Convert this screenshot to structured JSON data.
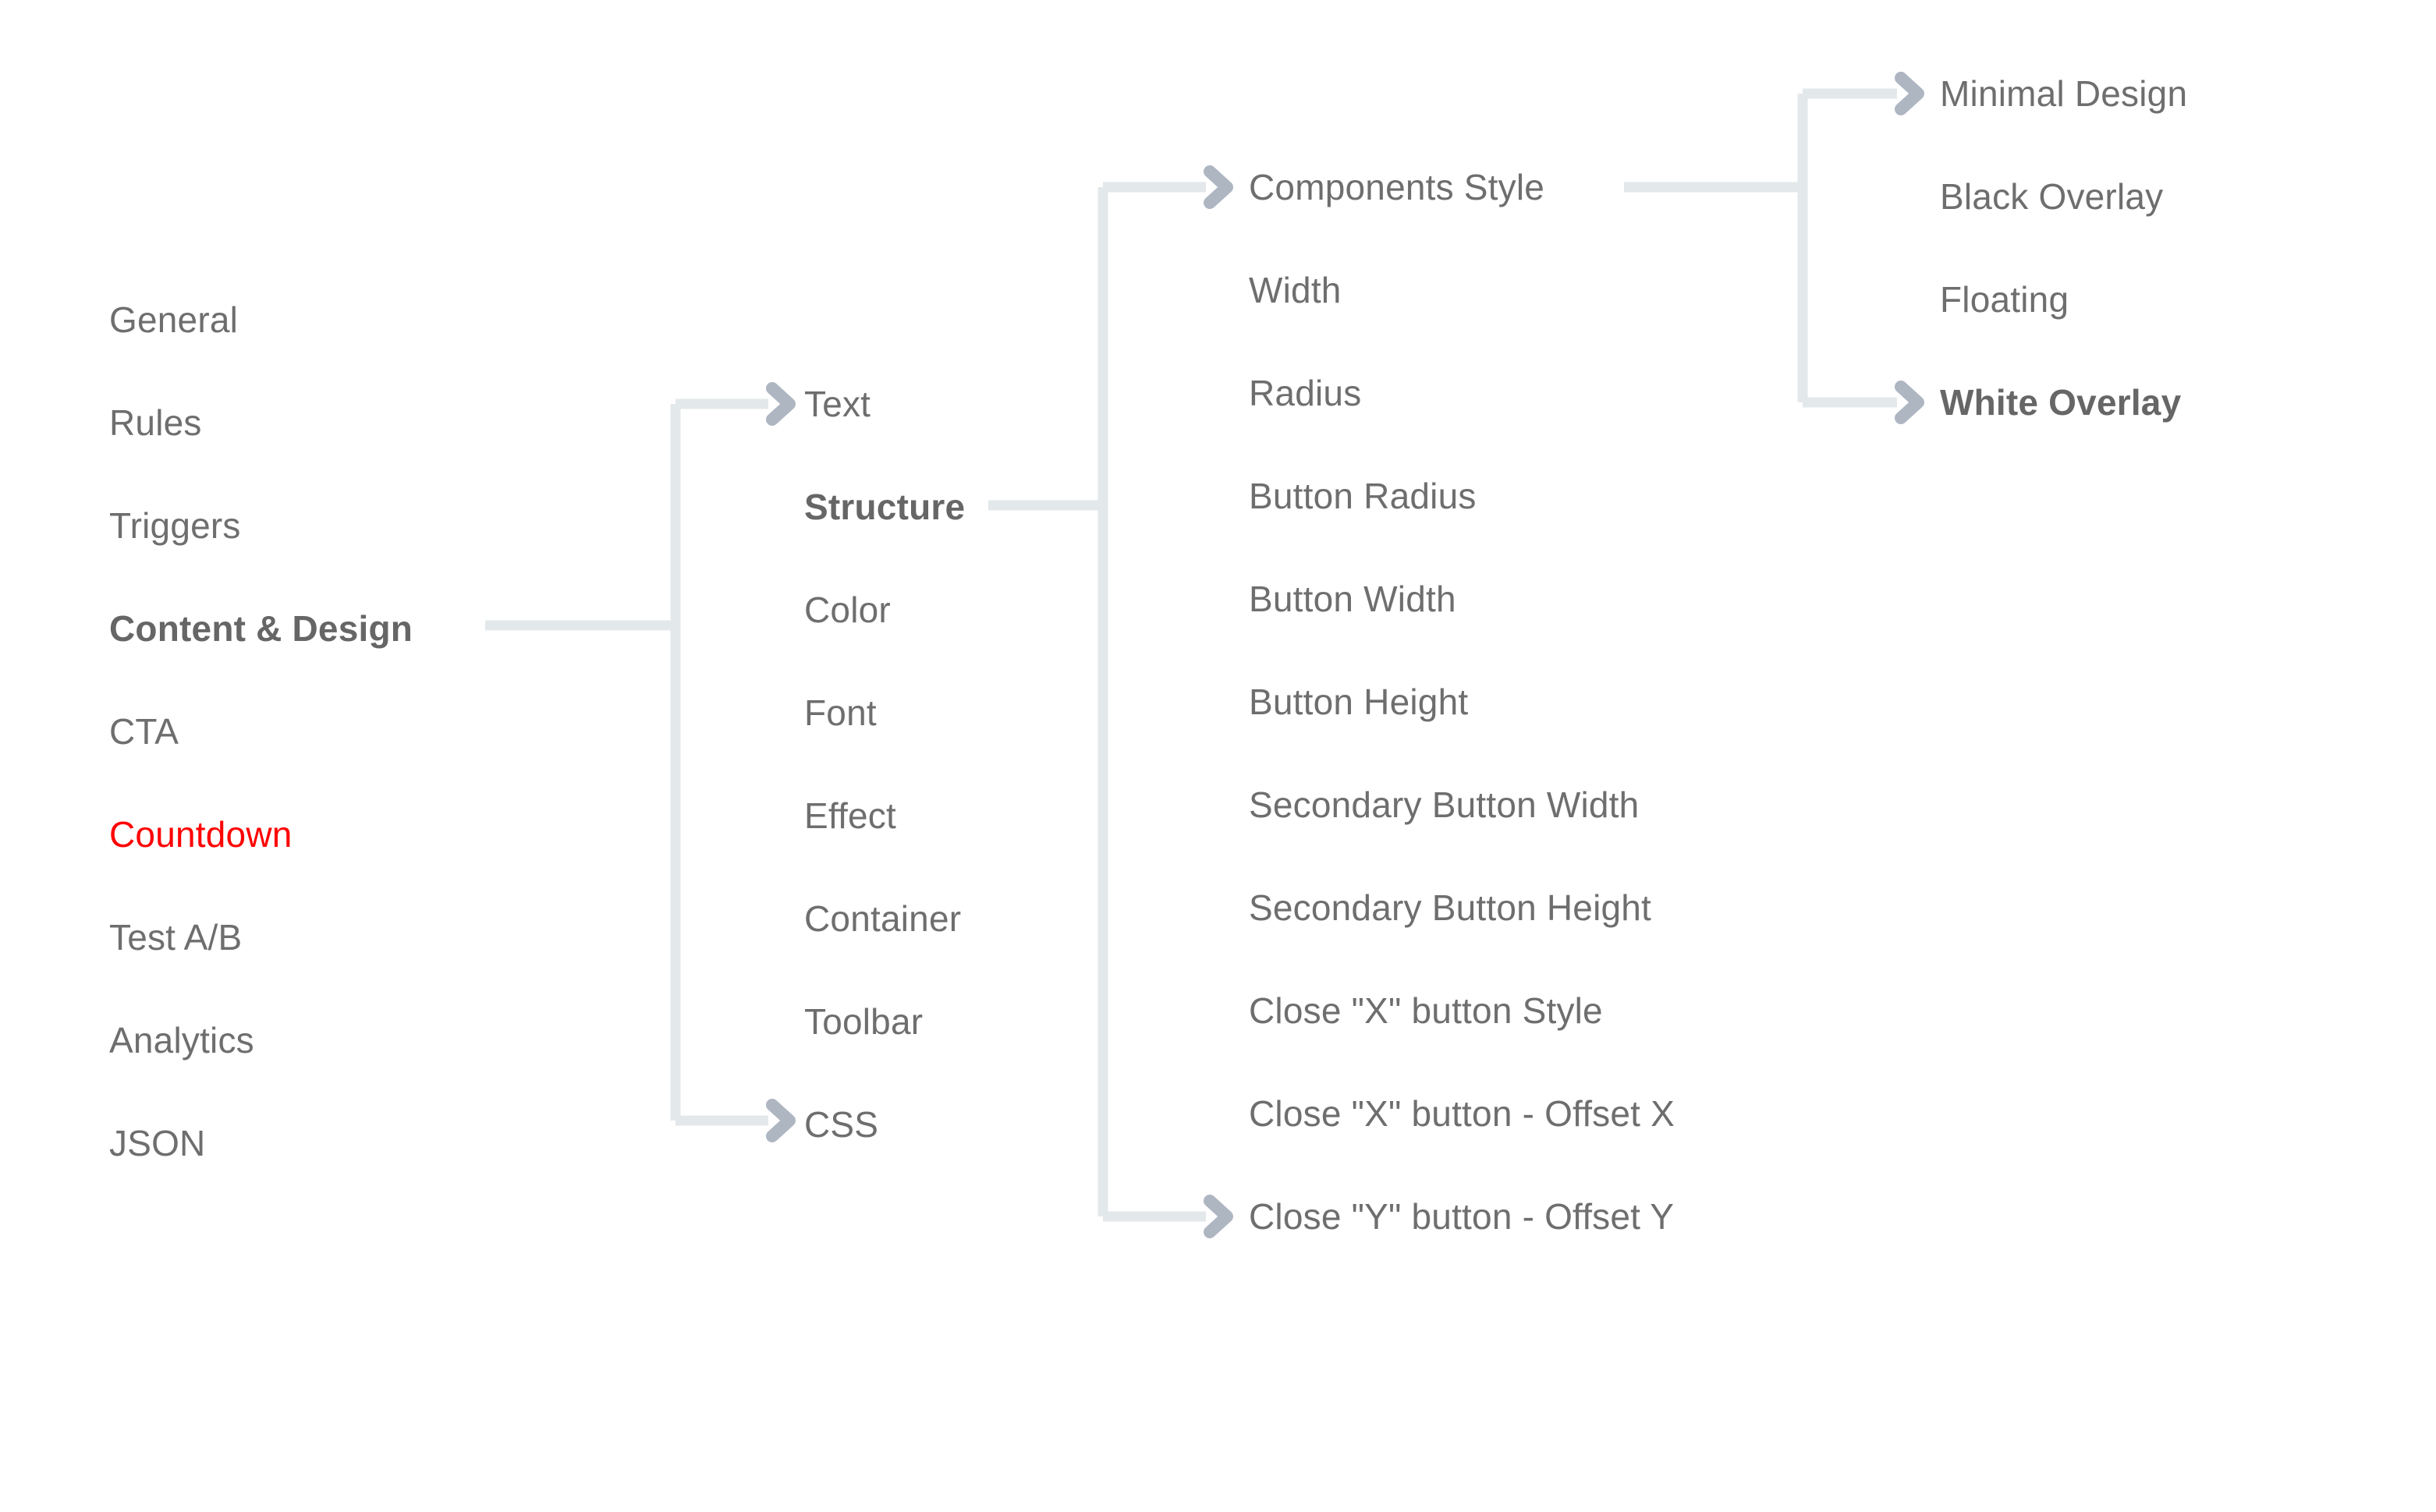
{
  "diagram": {
    "type": "navigation-tree",
    "line_color": "#e3e8eb",
    "arrow_color": "#aeb6c2",
    "text_color": "#6e6e6e",
    "highlight_color": "#ff0000",
    "columns": [
      {
        "name": "settings-sections",
        "items": [
          {
            "label": "General",
            "state": "normal"
          },
          {
            "label": "Rules",
            "state": "normal"
          },
          {
            "label": "Triggers",
            "state": "normal"
          },
          {
            "label": "Content & Design",
            "state": "bold"
          },
          {
            "label": "CTA",
            "state": "normal"
          },
          {
            "label": "Countdown",
            "state": "accent"
          },
          {
            "label": "Test A/B",
            "state": "normal"
          },
          {
            "label": "Analytics",
            "state": "normal"
          },
          {
            "label": "JSON",
            "state": "normal"
          }
        ]
      },
      {
        "name": "content-design-tabs",
        "items": [
          {
            "label": "Text",
            "state": "normal"
          },
          {
            "label": "Structure",
            "state": "bold"
          },
          {
            "label": "Color",
            "state": "normal"
          },
          {
            "label": "Font",
            "state": "normal"
          },
          {
            "label": "Effect",
            "state": "normal"
          },
          {
            "label": "Container",
            "state": "normal"
          },
          {
            "label": "Toolbar",
            "state": "normal"
          },
          {
            "label": "CSS",
            "state": "normal"
          }
        ]
      },
      {
        "name": "structure-options",
        "items": [
          {
            "label": "Components Style",
            "state": "normal"
          },
          {
            "label": "Width",
            "state": "normal"
          },
          {
            "label": "Radius",
            "state": "normal"
          },
          {
            "label": "Button Radius",
            "state": "normal"
          },
          {
            "label": "Button Width",
            "state": "normal"
          },
          {
            "label": "Button Height",
            "state": "normal"
          },
          {
            "label": "Secondary Button Width",
            "state": "normal"
          },
          {
            "label": "Secondary Button Height",
            "state": "normal"
          },
          {
            "label": "Close \"X\" button Style",
            "state": "normal"
          },
          {
            "label": "Close \"X\" button - Offset X",
            "state": "normal"
          },
          {
            "label": "Close \"Y\" button - Offset Y",
            "state": "normal"
          }
        ]
      },
      {
        "name": "components-style-options",
        "items": [
          {
            "label": "Minimal Design",
            "state": "normal"
          },
          {
            "label": "Black Overlay",
            "state": "normal"
          },
          {
            "label": "Floating",
            "state": "normal"
          },
          {
            "label": "White Overlay",
            "state": "bold"
          }
        ]
      }
    ]
  }
}
